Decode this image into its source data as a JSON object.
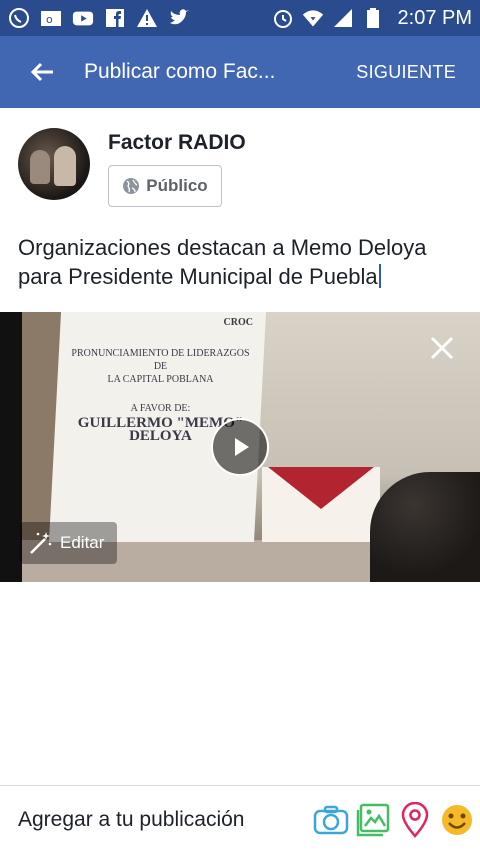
{
  "status_bar": {
    "time": "2:07 PM",
    "icons": [
      "whatsapp-icon",
      "outlook-icon",
      "youtube-icon",
      "facebook-icon",
      "warning-icon",
      "twitter-icon",
      "alarm-icon",
      "wifi-icon",
      "signal-icon",
      "battery-icon"
    ]
  },
  "app_bar": {
    "title": "Publicar como Fac...",
    "next_label": "SIGUIENTE"
  },
  "author": {
    "name": "Factor RADIO",
    "audience_label": "Público"
  },
  "post": {
    "text": "Organizaciones destacan a Memo Deloya para Presidente Municipal de Puebla"
  },
  "media": {
    "banner_line1": "PRONUNCIAMIENTO DE LIDERAZGOS DE",
    "banner_line2": "LA CAPITAL POBLANA",
    "banner_line3": "A FAVOR DE:",
    "banner_line4": "GUILLERMO \"MEMO\" DELOYA",
    "logo_text": "CROC",
    "edit_label": "Editar"
  },
  "bottom_bar": {
    "label": "Agregar a tu publicación",
    "tools": [
      "camera-icon",
      "photo-icon",
      "location-icon",
      "emoji-icon"
    ]
  },
  "colors": {
    "status_bar": "#2a4c8f",
    "app_bar": "#4267b2",
    "camera": "#3ba6d9",
    "photo": "#45bd62",
    "location": "#e0245e",
    "emoji": "#f7b928"
  }
}
